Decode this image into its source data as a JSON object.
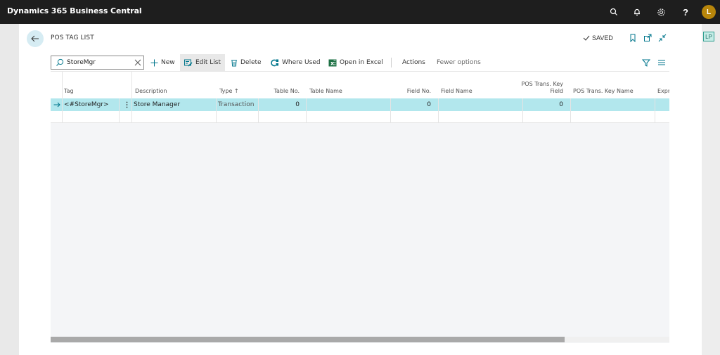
{
  "app": {
    "title": "Dynamics 365 Business Central",
    "user_initial": "L",
    "side_badge": "LP"
  },
  "page": {
    "title": "POS TAG LIST",
    "saved_status": "SAVED"
  },
  "search": {
    "value": "StoreMgr"
  },
  "actions": {
    "new": "New",
    "edit_list": "Edit List",
    "delete": "Delete",
    "where_used": "Where Used",
    "open_in_excel": "Open in Excel",
    "actions": "Actions",
    "fewer_options": "Fewer options"
  },
  "table": {
    "columns": {
      "tag": "Tag",
      "description": "Description",
      "type": "Type ↑",
      "table_no": "Table No.",
      "table_name": "Table Name",
      "field_no": "Field No.",
      "field_name": "Field Name",
      "pos_trans_key_field_line1": "POS Trans. Key",
      "pos_trans_key_field_line2": "Field",
      "pos_trans_key_name": "POS Trans. Key Name",
      "expression": "Expre"
    },
    "rows": [
      {
        "tag": "<#StoreMgr>",
        "description": "Store Manager",
        "type": "Transaction",
        "table_no": "0",
        "table_name": "",
        "field_no": "0",
        "field_name": "",
        "pos_trans_key_field": "0",
        "pos_trans_key_name": ""
      }
    ]
  },
  "colors": {
    "topbar": "#1e1e1e",
    "selected_row": "#b2e7ed",
    "accent": "#00768c",
    "excel_green": "#1e7145"
  },
  "scroll": {
    "horizontal_visible_fraction": 0.83
  }
}
